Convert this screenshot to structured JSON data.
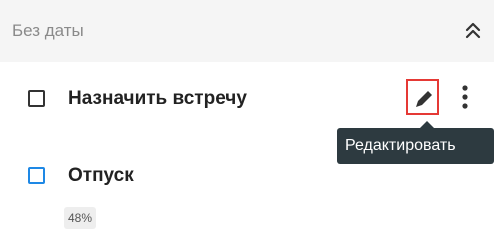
{
  "section": {
    "title": "Без даты",
    "collapse_icon": "double-chevron-up-icon"
  },
  "tasks": [
    {
      "title": "Назначить встречу",
      "checked": false,
      "checkbox_color": "#333333",
      "actions": {
        "edit_icon": "pencil-icon",
        "more_icon": "vertical-dots-icon",
        "highlight_color": "#e53935"
      }
    },
    {
      "title": "Отпуск",
      "checked": false,
      "checkbox_color": "#1e88e5",
      "progress": "48%"
    }
  ],
  "tooltip": {
    "text": "Редактировать"
  }
}
